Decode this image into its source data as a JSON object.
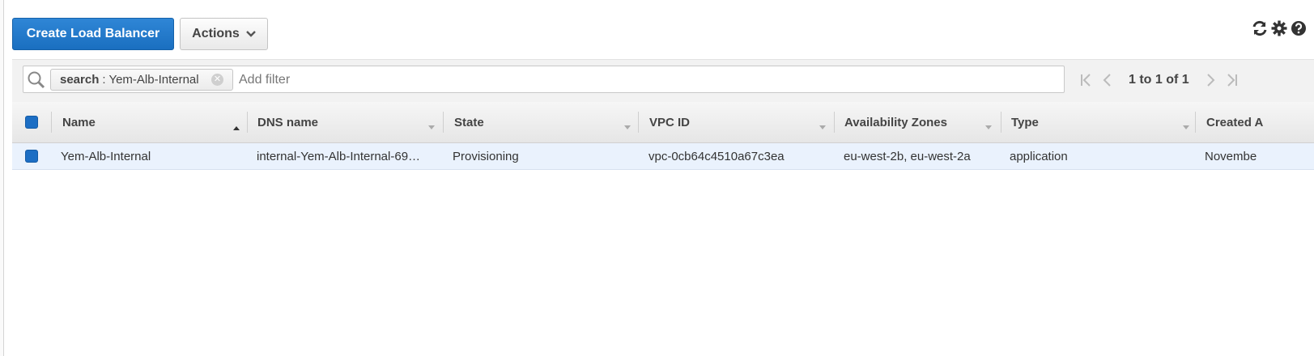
{
  "toolbar": {
    "create_label": "Create Load Balancer",
    "actions_label": "Actions"
  },
  "filter": {
    "token_key": "search",
    "token_value": ": Yem-Alb-Internal",
    "placeholder": "Add filter"
  },
  "pagination": {
    "label": "1 to 1 of 1"
  },
  "table": {
    "columns": [
      "Name",
      "DNS name",
      "State",
      "VPC ID",
      "Availability Zones",
      "Type",
      "Created A"
    ],
    "rows": [
      {
        "name": "Yem-Alb-Internal",
        "dns": "internal-Yem-Alb-Internal-69…",
        "state": "Provisioning",
        "vpc": "vpc-0cb64c4510a67c3ea",
        "zones": "eu-west-2b, eu-west-2a",
        "type": "application",
        "created": "Novembe"
      }
    ]
  },
  "colors": {
    "primary": "#1a6fc0",
    "selected_row": "#eaf2fd",
    "checkbox": "#1c6ec4"
  }
}
